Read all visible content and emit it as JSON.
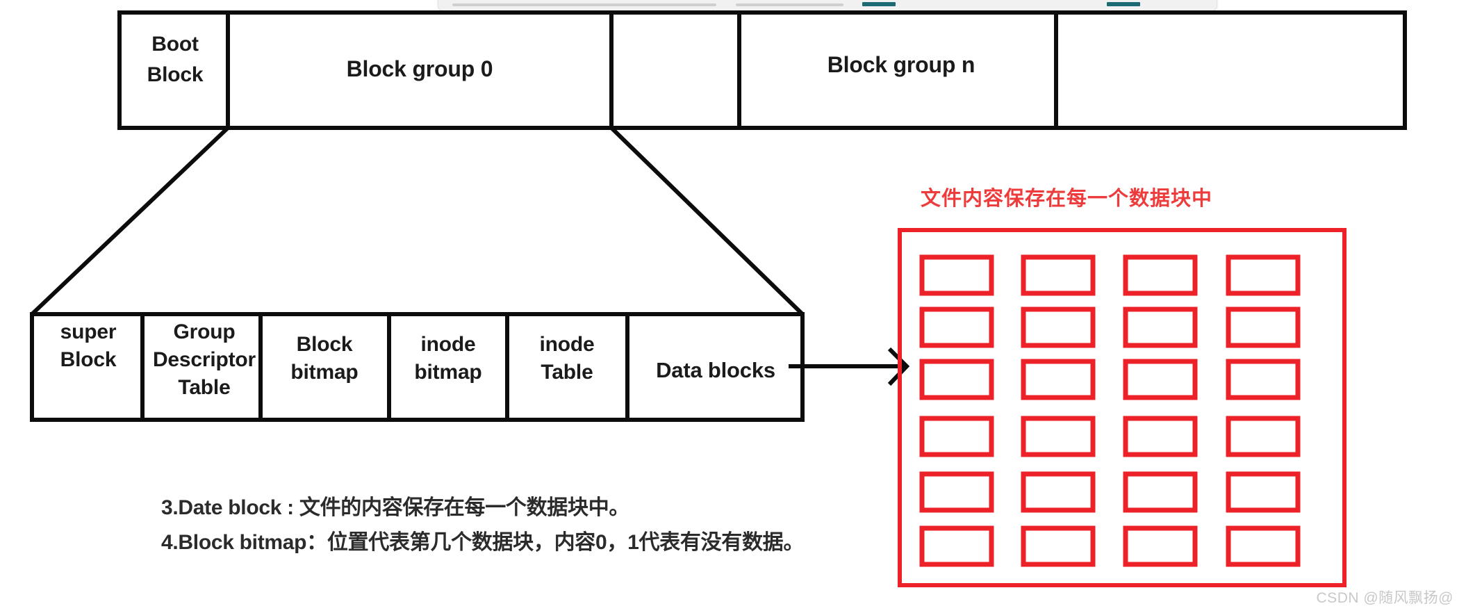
{
  "top_panel": {
    "accent_color": "#1c6b74",
    "background": "#f1f1f1"
  },
  "colors": {
    "ink": "#0c0c0c",
    "red": "#ed2128",
    "red_title": "#ee3b3b",
    "watermark": "#c8c8c8"
  },
  "disk_row": {
    "cells": [
      {
        "label": "Boot\nBlock"
      },
      {
        "label": "Block group 0"
      },
      {
        "label": ""
      },
      {
        "label": "Block group n"
      },
      {
        "label": ""
      }
    ]
  },
  "block_group_row": {
    "cells": [
      {
        "label": "super\nBlock"
      },
      {
        "label": "Group\nDescriptor\nTable"
      },
      {
        "label": "Block\nbitmap"
      },
      {
        "label": "inode\nbitmap"
      },
      {
        "label": "inode\nTable"
      },
      {
        "label": "Data blocks"
      }
    ]
  },
  "data_block_panel": {
    "title": "文件内容保存在每一个数据块中",
    "rows": 6,
    "columns": 4,
    "cell_count": 24
  },
  "notes": [
    "3.Date block : 文件的内容保存在每一个数据块中。",
    "4.Block bitmap：位置代表第几个数据块，内容0，1代表有没有数据。"
  ],
  "watermark": "CSDN @随风飘扬@"
}
